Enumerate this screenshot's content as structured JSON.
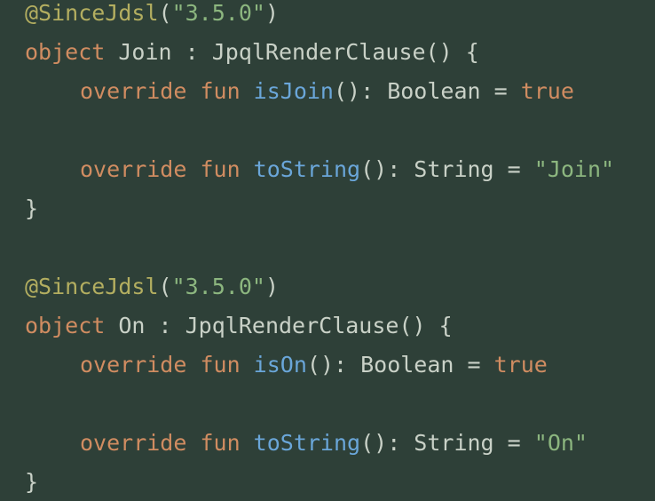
{
  "code": {
    "line1": {
      "annotation": "@SinceJdsl",
      "paren_open": "(",
      "version": "\"3.5.0\"",
      "paren_close": ")"
    },
    "line2": {
      "kw": "object",
      "name": " Join ",
      "rest": ": JpqlRenderClause() {"
    },
    "line3": {
      "kw": "override fun ",
      "fn": "isJoin",
      "mid": "(): Boolean = ",
      "val": "true"
    },
    "line5": {
      "kw": "override fun ",
      "fn": "toString",
      "mid": "(): String = ",
      "str": "\"Join\""
    },
    "line6": {
      "brace": "}"
    },
    "line8": {
      "annotation": "@SinceJdsl",
      "paren_open": "(",
      "version": "\"3.5.0\"",
      "paren_close": ")"
    },
    "line9": {
      "kw": "object",
      "name": " On ",
      "rest": ": JpqlRenderClause() {"
    },
    "line10": {
      "kw": "override fun ",
      "fn": "isOn",
      "mid": "(): Boolean = ",
      "val": "true"
    },
    "line12": {
      "kw": "override fun ",
      "fn": "toString",
      "mid": "(): String = ",
      "str": "\"On\""
    },
    "line13": {
      "brace": "}"
    }
  },
  "colors": {
    "background": "#2e4038",
    "annotation": "#b3ae60",
    "keyword": "#d08c61",
    "string": "#8cb67f",
    "function": "#6aa6d9",
    "text": "#c9d1c7"
  }
}
